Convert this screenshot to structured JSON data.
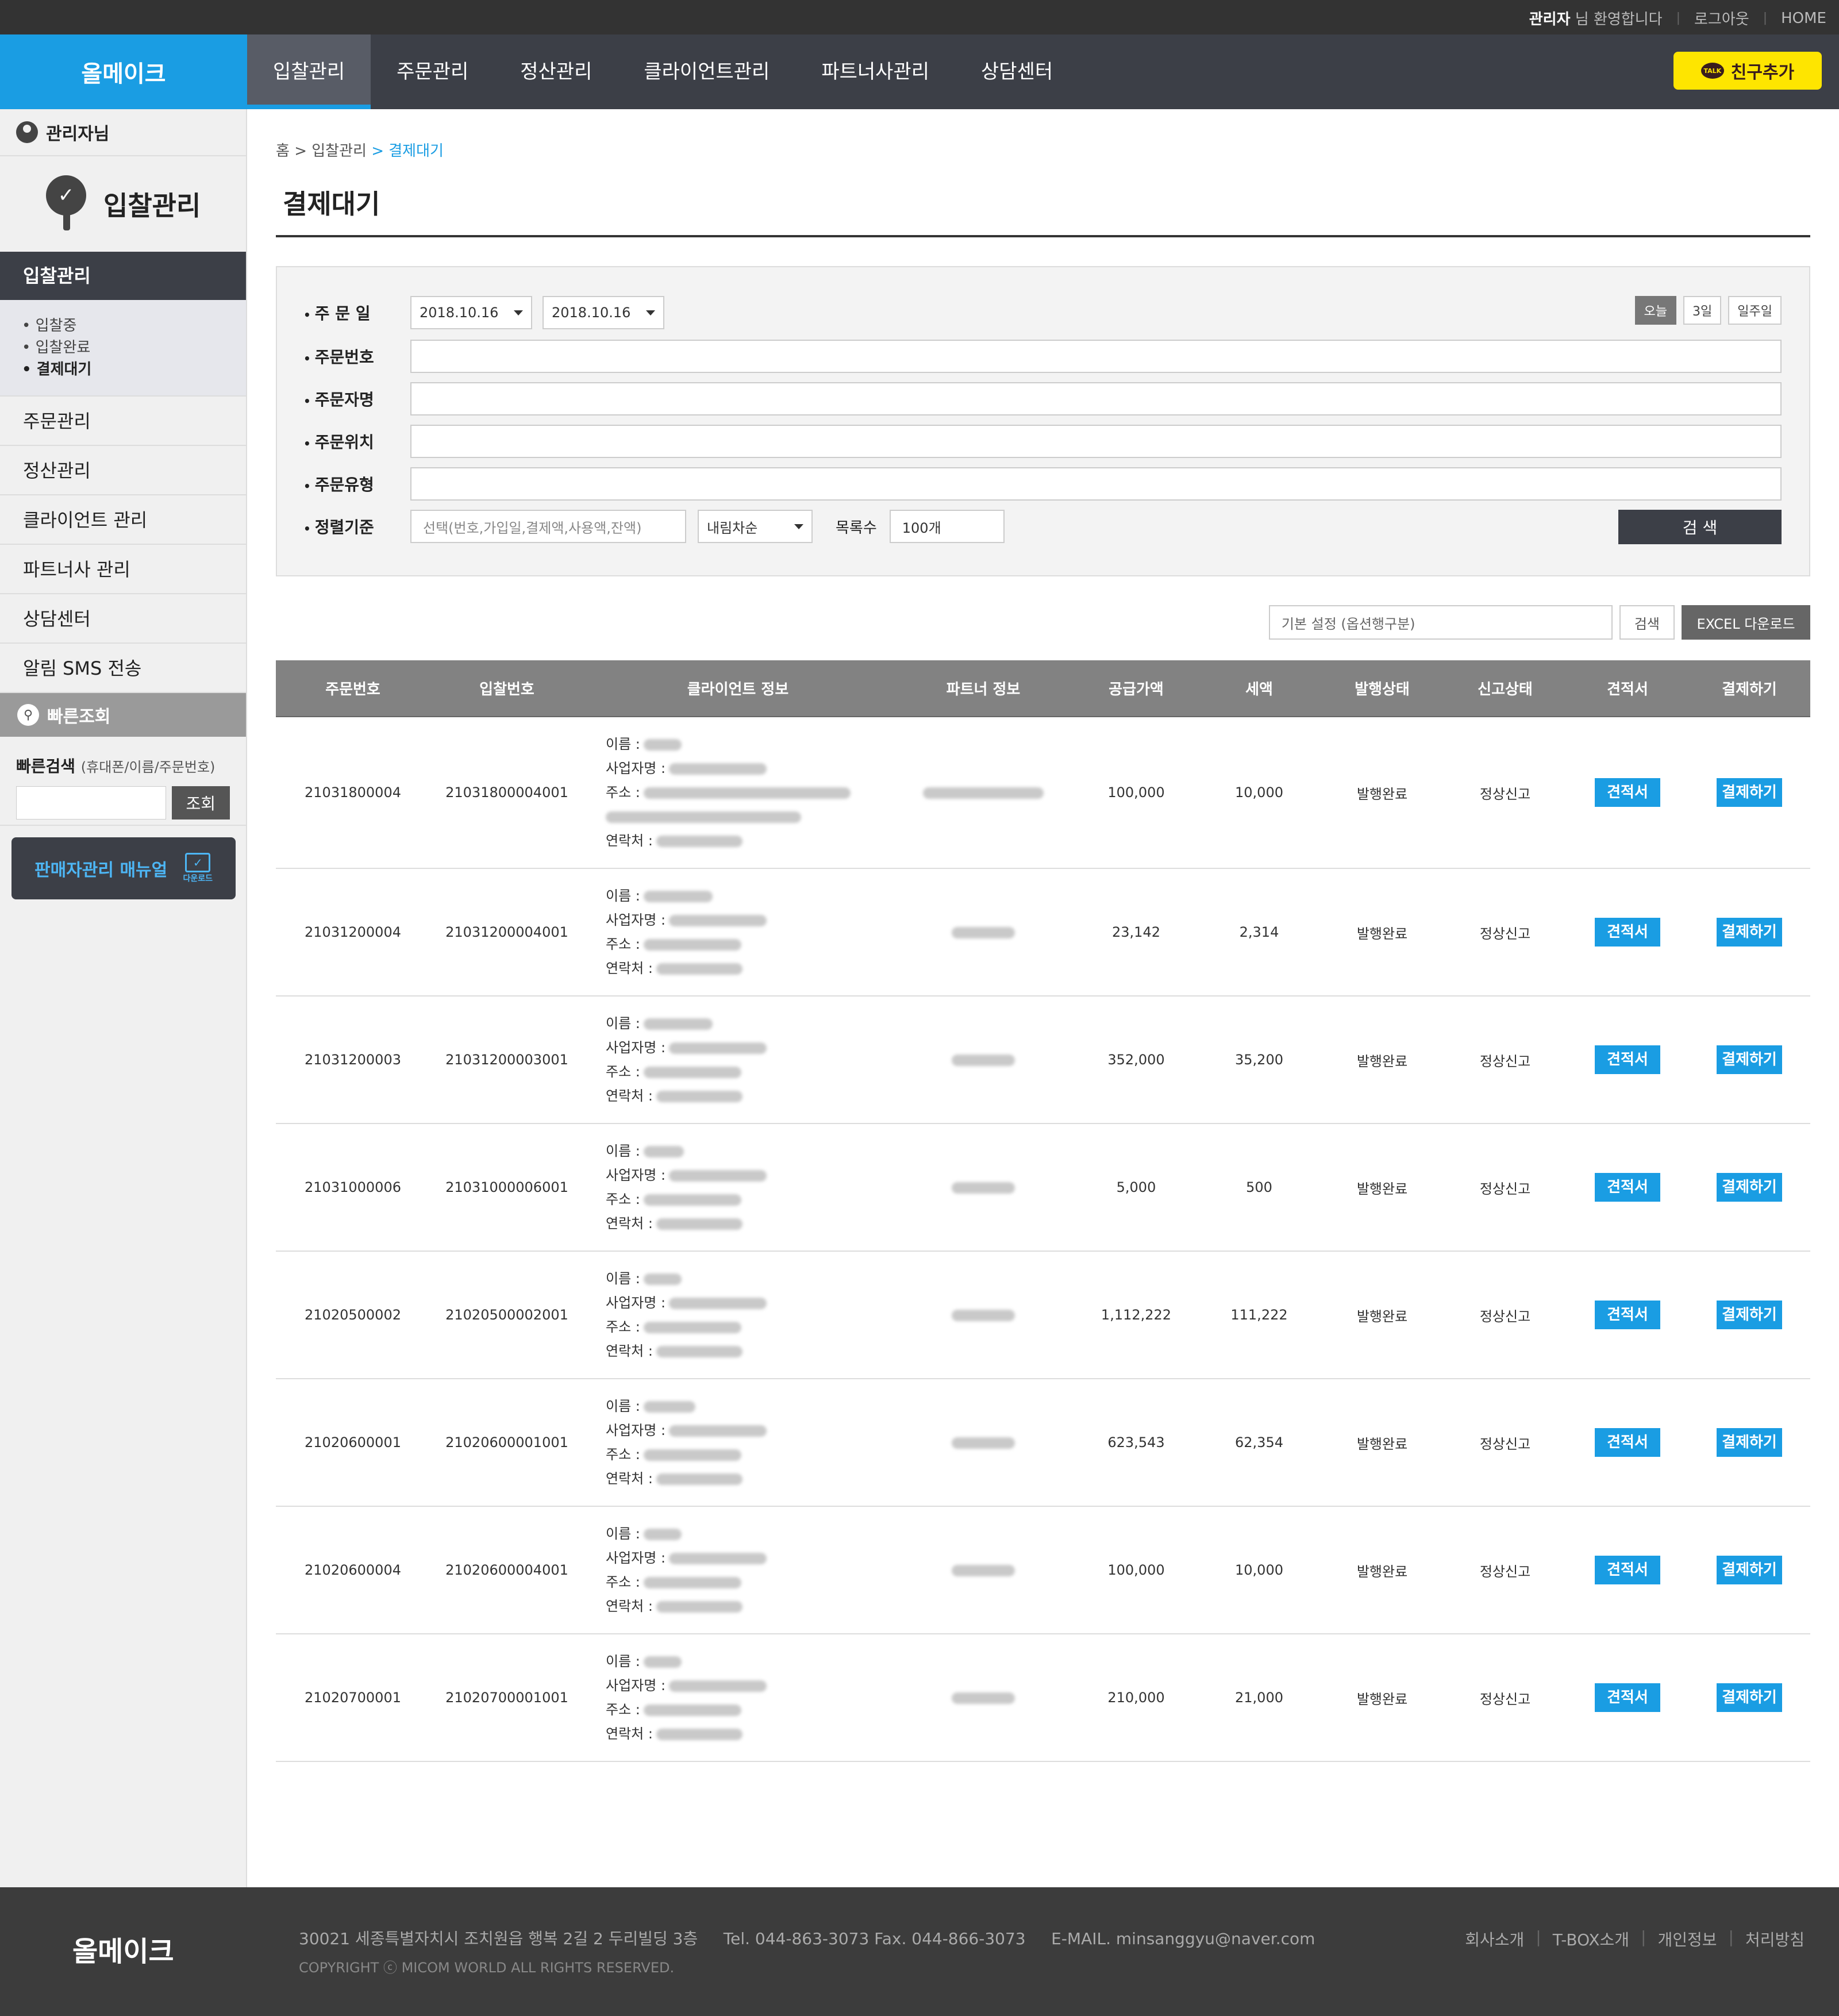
{
  "topbar": {
    "welcome_name": "관리자",
    "welcome_text": " 님 환영합니다",
    "logout": "로그아웃",
    "home": "HOME"
  },
  "gnb": {
    "logo": "올메이크",
    "menu": [
      "입찰관리",
      "주문관리",
      "정산관리",
      "클라이언트관리",
      "파트너사관리",
      "상담센터"
    ],
    "active": 0,
    "kakao": "친구추가",
    "kakao_badge": "TALK"
  },
  "sidebar": {
    "admin": "관리자님",
    "heading": "입찰관리",
    "current": "입찰관리",
    "sub": [
      "입찰중",
      "입찰완료",
      "결제대기"
    ],
    "sub_active": 2,
    "items": [
      "주문관리",
      "정산관리",
      "클라이언트 관리",
      "파트너사 관리",
      "상담센터",
      "알림 SMS 전송"
    ],
    "quick_title": "빠른조회",
    "quick_label": "빠른검색",
    "quick_hint": "(휴대폰/이름/주문번호)",
    "quick_btn": "조회",
    "manual": "판매자관리 매뉴얼",
    "manual_dl": "다운로드"
  },
  "breadcrumb": {
    "home": "홈",
    "sep": ">",
    "parent": "입찰관리",
    "current": "결제대기"
  },
  "page_title": "결제대기",
  "filter": {
    "date_label": "주 문 일",
    "date_from": "2018.10.16",
    "date_to": "2018.10.16",
    "periods": [
      "오늘",
      "3일",
      "일주일"
    ],
    "order_no": "주문번호",
    "orderer": "주문자명",
    "location": "주문위치",
    "type": "주문유형",
    "sort_label": "정렬기준",
    "sort_placeholder": "선택(번호,가입일,결제액,사용액,잔액)",
    "sort_order": "내림차순",
    "count_label": "목록수",
    "count_value": "100개",
    "search_btn": "검 색"
  },
  "tools": {
    "preset_placeholder": "기본 설정 (옵션행구분)",
    "search": "검색",
    "excel": "EXCEL 다운로드"
  },
  "table": {
    "headers": [
      "주문번호",
      "입찰번호",
      "클라이언트 정보",
      "파트너 정보",
      "공급가액",
      "세액",
      "발행상태",
      "신고상태",
      "견적서",
      "결제하기"
    ],
    "info_labels": [
      "이름 :",
      "사업자명 :",
      "주소 :",
      "연락처 :"
    ],
    "btn_quote": "견적서",
    "btn_pay": "결제하기",
    "rows": [
      {
        "order": "21031800004",
        "bid": "21031800004001",
        "supply": "100,000",
        "tax": "10,000",
        "issue": "발행완료",
        "report": "정상신고"
      },
      {
        "order": "21031200004",
        "bid": "21031200004001",
        "supply": "23,142",
        "tax": "2,314",
        "issue": "발행완료",
        "report": "정상신고"
      },
      {
        "order": "21031200003",
        "bid": "21031200003001",
        "supply": "352,000",
        "tax": "35,200",
        "issue": "발행완료",
        "report": "정상신고"
      },
      {
        "order": "21031000006",
        "bid": "21031000006001",
        "supply": "5,000",
        "tax": "500",
        "issue": "발행완료",
        "report": "정상신고"
      },
      {
        "order": "21020500002",
        "bid": "21020500002001",
        "supply": "1,112,222",
        "tax": "111,222",
        "issue": "발행완료",
        "report": "정상신고"
      },
      {
        "order": "21020600001",
        "bid": "21020600001001",
        "supply": "623,543",
        "tax": "62,354",
        "issue": "발행완료",
        "report": "정상신고"
      },
      {
        "order": "21020600004",
        "bid": "21020600004001",
        "supply": "100,000",
        "tax": "10,000",
        "issue": "발행완료",
        "report": "정상신고"
      },
      {
        "order": "21020700001",
        "bid": "21020700001001",
        "supply": "210,000",
        "tax": "21,000",
        "issue": "발행완료",
        "report": "정상신고"
      }
    ]
  },
  "footer": {
    "logo": "올메이크",
    "address": "30021 세종특별자치시 조치원읍 행복 2길 2 두리빌딩 3층",
    "tel": "Tel. 044-863-3073 Fax. 044-866-3073",
    "email": "E-MAIL. minsanggyu@naver.com",
    "copyright": "COPYRIGHT ⓒ MICOM WORLD ALL RIGHTS RESERVED.",
    "links": [
      "회사소개",
      "T-BOX소개",
      "개인정보",
      "처리방침"
    ]
  },
  "colors": {
    "accent": "#1a9de3",
    "nav": "#3c3f47",
    "kakao": "#fee500"
  }
}
